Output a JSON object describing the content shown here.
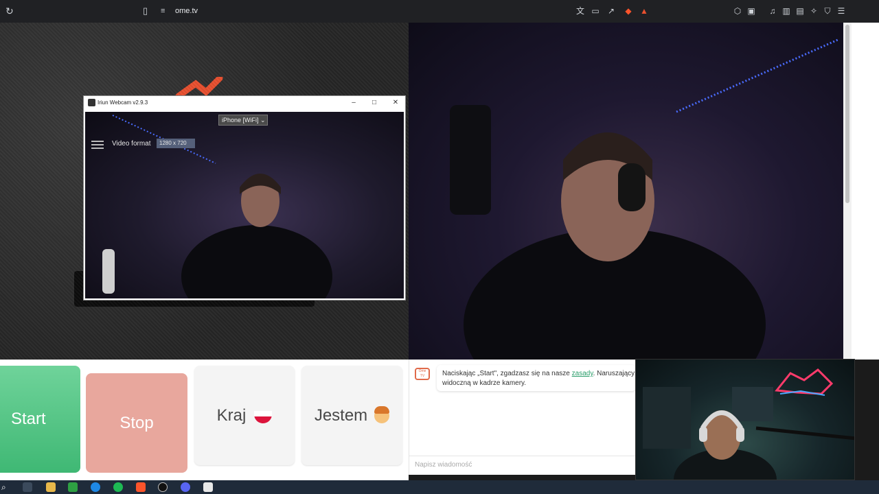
{
  "browser": {
    "url": "ome.tv",
    "icons": [
      "reload-icon",
      "bookmark-icon",
      "site-info-icon",
      "translate-icon",
      "screen-cast-icon",
      "share-icon",
      "brave-shield-icon",
      "brave-rewards-icon",
      "extensions-icon",
      "sidebar-icon",
      "media-icon",
      "split-view-icon",
      "wallet-icon",
      "leo-icon",
      "vpn-icon",
      "menu-icon"
    ]
  },
  "webcam_window": {
    "title": "Iriun Webcam v2.9.3",
    "device": "iPhone [WiFi]",
    "video_format_label": "Video format",
    "video_format_value": "1280 x 720"
  },
  "controls": {
    "start_label": "Start",
    "stop_label": "Stop",
    "country_label": "Kraj",
    "gender_label": "Jestem"
  },
  "chat": {
    "message_before_link": "Naciskając „Start\", zgadzasz się na nasze ",
    "rules_link": "zasady",
    "message_after_link": ". Naruszający z",
    "message_line2": "widoczną w kadrze kamery.",
    "input_placeholder": "Napisz wiadomość"
  },
  "colors": {
    "start": "#4cc383",
    "stop": "#e8a79d",
    "link": "#2a9d6a",
    "brand_orange": "#e8502f"
  },
  "taskbar": {
    "icons": [
      "search-icon",
      "task-view-icon",
      "file-explorer-icon",
      "calendar-app-icon",
      "edge-icon",
      "spotify-icon",
      "brave-icon",
      "obs-icon",
      "discord-icon",
      "iriun-icon"
    ]
  }
}
